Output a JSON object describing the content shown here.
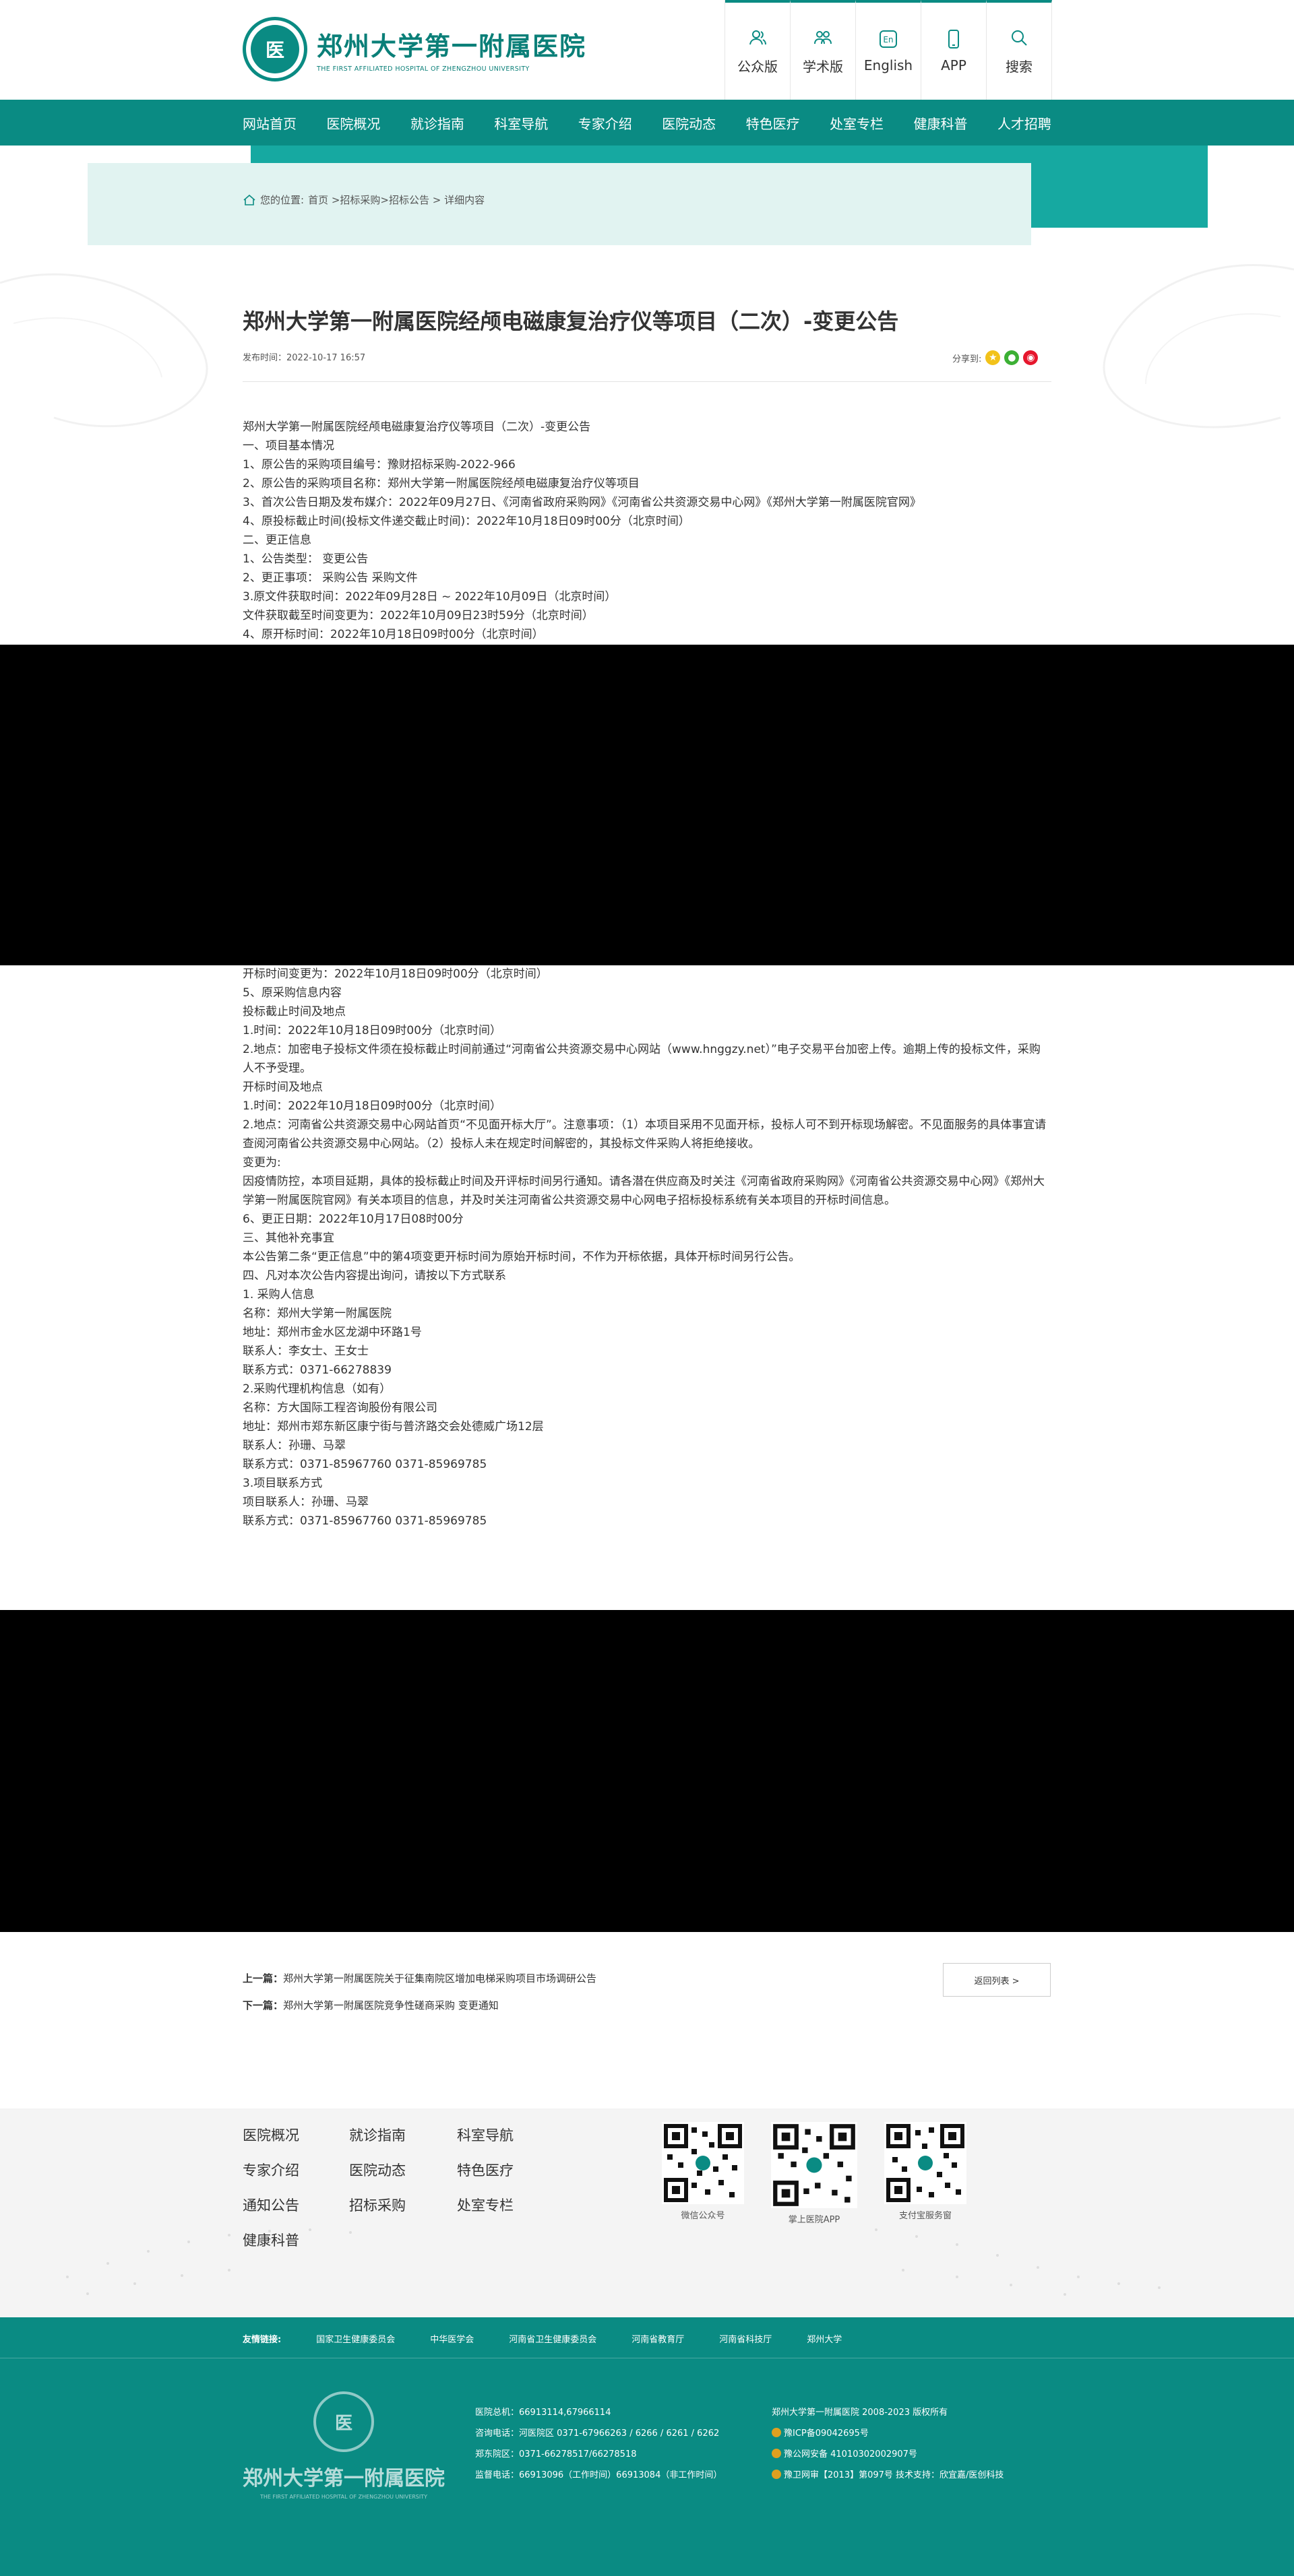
{
  "header": {
    "logo_cn": "郑州大学第一附属医院",
    "logo_en": "THE FIRST AFFILIATED HOSPITAL OF ZHENGZHOU UNIVERSITY",
    "top_links": [
      {
        "label": "公众版",
        "icon": "people-icon"
      },
      {
        "label": "学术版",
        "icon": "group-icon"
      },
      {
        "label": "English",
        "icon": "en-icon"
      },
      {
        "label": "APP",
        "icon": "phone-icon"
      },
      {
        "label": "搜索",
        "icon": "search-icon"
      }
    ]
  },
  "nav": [
    "网站首页",
    "医院概况",
    "就诊指南",
    "科室导航",
    "专家介绍",
    "医院动态",
    "特色医疗",
    "处室专栏",
    "健康科普",
    "人才招聘"
  ],
  "breadcrumb": {
    "prefix": "您的位置:",
    "path": "首页 >招标采购>招标公告 > 详细内容"
  },
  "article": {
    "title": "郑州大学第一附属医院经颅电磁康复治疗仪等项目（二次）-变更公告",
    "publish_time": "发布时间：2022-10-17 16:57",
    "share_label": "分享到:",
    "paragraphs_top": [
      "郑州大学第一附属医院经颅电磁康复治疗仪等项目（二次）-变更公告",
      "一、项目基本情况",
      "1、原公告的采购项目编号：豫财招标采购-2022-966",
      "2、原公告的采购项目名称：郑州大学第一附属医院经颅电磁康复治疗仪等项目",
      "3、首次公告日期及发布媒介：2022年09月27日、《河南省政府采购网》《河南省公共资源交易中心网》《郑州大学第一附属医院官网》",
      "4、原投标截止时间(投标文件递交截止时间)：2022年10月18日09时00分（北京时间）",
      "二、更正信息",
      "1、公告类型： 变更公告",
      "2、更正事项： 采购公告 采购文件",
      "3.原文件获取时间：2022年09月28日 ~ 2022年10月09日（北京时间）",
      "文件获取截至时间变更为：2022年10月09日23时59分（北京时间）",
      "4、原开标时间：2022年10月18日09时00分（北京时间）"
    ],
    "paragraphs_bottom": [
      "开标时间变更为：2022年10月18日09时00分（北京时间）",
      "5、原采购信息内容",
      "投标截止时间及地点",
      "1.时间：2022年10月18日09时00分（北京时间）",
      "2.地点：加密电子投标文件须在投标截止时间前通过“河南省公共资源交易中心网站（www.hnggzy.net）”电子交易平台加密上传。逾期上传的投标文件，采购人不予受理。",
      "开标时间及地点",
      "1.时间：2022年10月18日09时00分（北京时间）",
      "2.地点：河南省公共资源交易中心网站首页“不见面开标大厅”。注意事项：（1）本项目采用不见面开标，投标人可不到开标现场解密。不见面服务的具体事宜请查阅河南省公共资源交易中心网站。（2）投标人未在规定时间解密的，其投标文件采购人将拒绝接收。",
      "变更为:",
      "因疫情防控，本项目延期，具体的投标截止时间及开评标时间另行通知。请各潜在供应商及时关注《河南省政府采购网》《河南省公共资源交易中心网》《郑州大学第一附属医院官网》有关本项目的信息，并及时关注河南省公共资源交易中心网电子招标投标系统有关本项目的开标时间信息。",
      "6、更正日期：2022年10月17日08时00分",
      "三、其他补充事宜",
      "本公告第二条“更正信息”中的第4项变更开标时间为原始开标时间，不作为开标依据，具体开标时间另行公告。",
      "四、凡对本次公告内容提出询问，请按以下方式联系",
      "1. 采购人信息",
      "名称：郑州大学第一附属医院",
      "地址：郑州市金水区龙湖中环路1号",
      "联系人：李女士、王女士",
      "联系方式：0371-66278839",
      "2.采购代理机构信息（如有）",
      "名称：方大国际工程咨询股份有限公司",
      "地址：郑州市郑东新区康宁街与普济路交会处德威广场12层",
      "联系人：孙珊、马翠",
      "联系方式：0371-85967760  0371-85969785",
      "3.项目联系方式",
      "项目联系人：孙珊、马翠",
      "联系方式：0371-85967760  0371-85969785"
    ]
  },
  "pager": {
    "prev_label": "上一篇：",
    "prev_title": "郑州大学第一附属医院关于征集南院区增加电梯采购项目市场调研公告",
    "next_label": "下一篇：",
    "next_title": "郑州大学第一附属医院竞争性磋商采购 变更通知",
    "back_label": "返回列表 >"
  },
  "footer": {
    "links": [
      "医院概况",
      "就诊指南",
      "科室导航",
      "专家介绍",
      "医院动态",
      "特色医疗",
      "通知公告",
      "招标采购",
      "处室专栏",
      "健康科普"
    ],
    "qrcodes": [
      "微信公众号",
      "掌上医院APP",
      "支付宝服务窗"
    ],
    "friend_label": "友情链接:",
    "friend_links": [
      "国家卫生健康委员会",
      "中华医学会",
      "河南省卫生健康委员会",
      "河南省教育厅",
      "河南省科技厅",
      "郑州大学"
    ],
    "contact": [
      "医院总机：66913114,67966114",
      "咨询电话：河医院区 0371-67966263 / 6266 / 6261 / 6262",
      "郑东院区：0371-66278517/66278518",
      "监督电话：66913096（工作时间）66913084（非工作时间）"
    ],
    "copyright": [
      "郑州大学第一附属医院 2008-2023 版权所有",
      "豫ICP备09042695号",
      "豫公网安备 41010302002907号",
      "豫卫网审【2013】第097号    技术支持：欣宜嘉/医创科技"
    ]
  }
}
